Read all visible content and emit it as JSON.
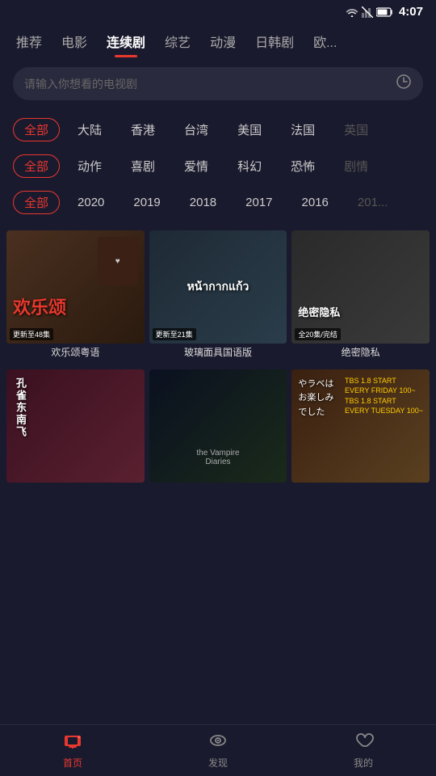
{
  "statusBar": {
    "time": "4:07",
    "icons": [
      "wifi",
      "signal",
      "battery"
    ]
  },
  "navTabs": {
    "items": [
      {
        "id": "recommend",
        "label": "推荐",
        "active": false
      },
      {
        "id": "movie",
        "label": "电影",
        "active": false
      },
      {
        "id": "series",
        "label": "连续剧",
        "active": true
      },
      {
        "id": "variety",
        "label": "综艺",
        "active": false
      },
      {
        "id": "anime",
        "label": "动漫",
        "active": false
      },
      {
        "id": "korean",
        "label": "日韩剧",
        "active": false
      },
      {
        "id": "europe",
        "label": "欧...",
        "active": false
      }
    ]
  },
  "search": {
    "placeholder": "请输入你想看的电视剧"
  },
  "filters": {
    "region": {
      "items": [
        {
          "id": "all",
          "label": "全部",
          "active": true
        },
        {
          "id": "mainland",
          "label": "大陆",
          "active": false
        },
        {
          "id": "hongkong",
          "label": "香港",
          "active": false
        },
        {
          "id": "taiwan",
          "label": "台湾",
          "active": false
        },
        {
          "id": "usa",
          "label": "美国",
          "active": false
        },
        {
          "id": "france",
          "label": "法国",
          "active": false
        },
        {
          "id": "uk",
          "label": "英国",
          "active": false,
          "dim": true
        }
      ]
    },
    "genre": {
      "items": [
        {
          "id": "all",
          "label": "全部",
          "active": true
        },
        {
          "id": "action",
          "label": "动作",
          "active": false
        },
        {
          "id": "comedy",
          "label": "喜剧",
          "active": false
        },
        {
          "id": "romance",
          "label": "爱情",
          "active": false
        },
        {
          "id": "scifi",
          "label": "科幻",
          "active": false
        },
        {
          "id": "horror",
          "label": "恐怖",
          "active": false
        },
        {
          "id": "drama",
          "label": "剧情",
          "active": false,
          "dim": true
        }
      ]
    },
    "year": {
      "items": [
        {
          "id": "all",
          "label": "全部",
          "active": true
        },
        {
          "id": "2020",
          "label": "2020",
          "active": false
        },
        {
          "id": "2019",
          "label": "2019",
          "active": false
        },
        {
          "id": "2018",
          "label": "2018",
          "active": false
        },
        {
          "id": "2017",
          "label": "2017",
          "active": false
        },
        {
          "id": "2016",
          "label": "2016",
          "active": false
        },
        {
          "id": "old",
          "label": "201...",
          "active": false,
          "dim": true
        }
      ]
    }
  },
  "contentGrid": {
    "items": [
      {
        "id": "item1",
        "title": "欢乐颂粤语",
        "badge": "更新至48集",
        "thumbColor": "thumb-1",
        "thumbText": "欢乐颂"
      },
      {
        "id": "item2",
        "title": "玻璃面具国语版",
        "badge": "更新至21集",
        "thumbColor": "thumb-2",
        "thumbText": "หน้ากากแก้ว"
      },
      {
        "id": "item3",
        "title": "绝密隐私",
        "badge": "全20集/完结",
        "thumbColor": "thumb-3",
        "thumbText": "绝密隐私"
      },
      {
        "id": "item4",
        "title": "",
        "badge": "",
        "thumbColor": "thumb-4",
        "thumbText": "孔雀东南飞"
      },
      {
        "id": "item5",
        "title": "",
        "badge": "",
        "thumbColor": "thumb-5",
        "thumbText": "The Vampire Diaries"
      },
      {
        "id": "item6",
        "title": "",
        "badge": "",
        "thumbColor": "thumb-6",
        "thumbText": "やラベは\nお楽しみ\nでした"
      }
    ]
  },
  "bottomNav": {
    "items": [
      {
        "id": "home",
        "label": "首页",
        "active": true,
        "icon": "tv"
      },
      {
        "id": "discover",
        "label": "发现",
        "active": false,
        "icon": "eye"
      },
      {
        "id": "mine",
        "label": "我的",
        "active": false,
        "icon": "heart"
      }
    ]
  }
}
